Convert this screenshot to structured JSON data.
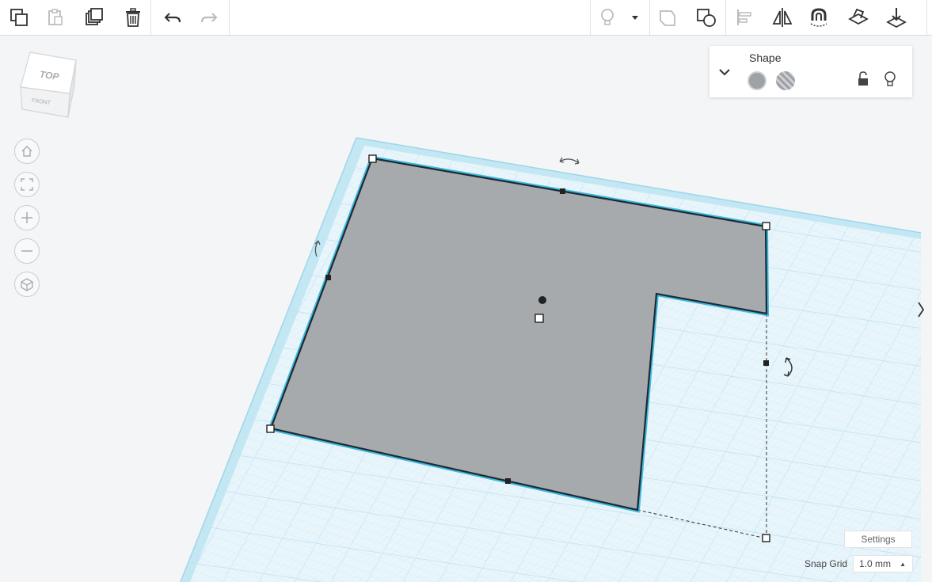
{
  "toolbar": {
    "left_tools": [
      {
        "name": "copy-icon",
        "label": "Copy"
      },
      {
        "name": "paste-icon",
        "label": "Paste"
      },
      {
        "name": "duplicate-icon",
        "label": "Duplicate and repeat"
      },
      {
        "name": "delete-icon",
        "label": "Delete"
      },
      {
        "name": "undo-icon",
        "label": "Undo"
      },
      {
        "name": "redo-icon",
        "label": "Redo"
      }
    ],
    "right_tools": [
      {
        "name": "show-all-icon",
        "label": "Show all"
      },
      {
        "name": "group-icon",
        "label": "Group"
      },
      {
        "name": "ungroup-icon",
        "label": "Ungroup"
      },
      {
        "name": "align-icon",
        "label": "Align"
      },
      {
        "name": "mirror-icon",
        "label": "Mirror"
      },
      {
        "name": "cruise-icon",
        "label": "Cruise"
      },
      {
        "name": "workplane-icon",
        "label": "Workplane"
      },
      {
        "name": "drop-icon",
        "label": "Drop"
      }
    ]
  },
  "viewcube": {
    "top_label": "TOP",
    "front_label": "FRONT"
  },
  "navigation": [
    {
      "name": "home-view-button",
      "icon": "home-icon"
    },
    {
      "name": "fit-view-button",
      "icon": "fit-icon"
    },
    {
      "name": "zoom-in-button",
      "icon": "plus-icon"
    },
    {
      "name": "zoom-out-button",
      "icon": "minus-icon"
    },
    {
      "name": "projection-button",
      "icon": "cube-icon"
    }
  ],
  "inspector": {
    "title": "Shape",
    "solid_color": "#9ea2a6",
    "hole_label": "Hole"
  },
  "canvas": {
    "grid_color": "#bfe3f2",
    "grid_fill": "#e6f4fa",
    "edge_color": "#aee0ef",
    "shape_color": "#a7aaac",
    "selection_color": "#2bb1da"
  },
  "settings_label": "Settings",
  "snap_grid": {
    "label": "Snap Grid",
    "value": "1.0 mm"
  }
}
